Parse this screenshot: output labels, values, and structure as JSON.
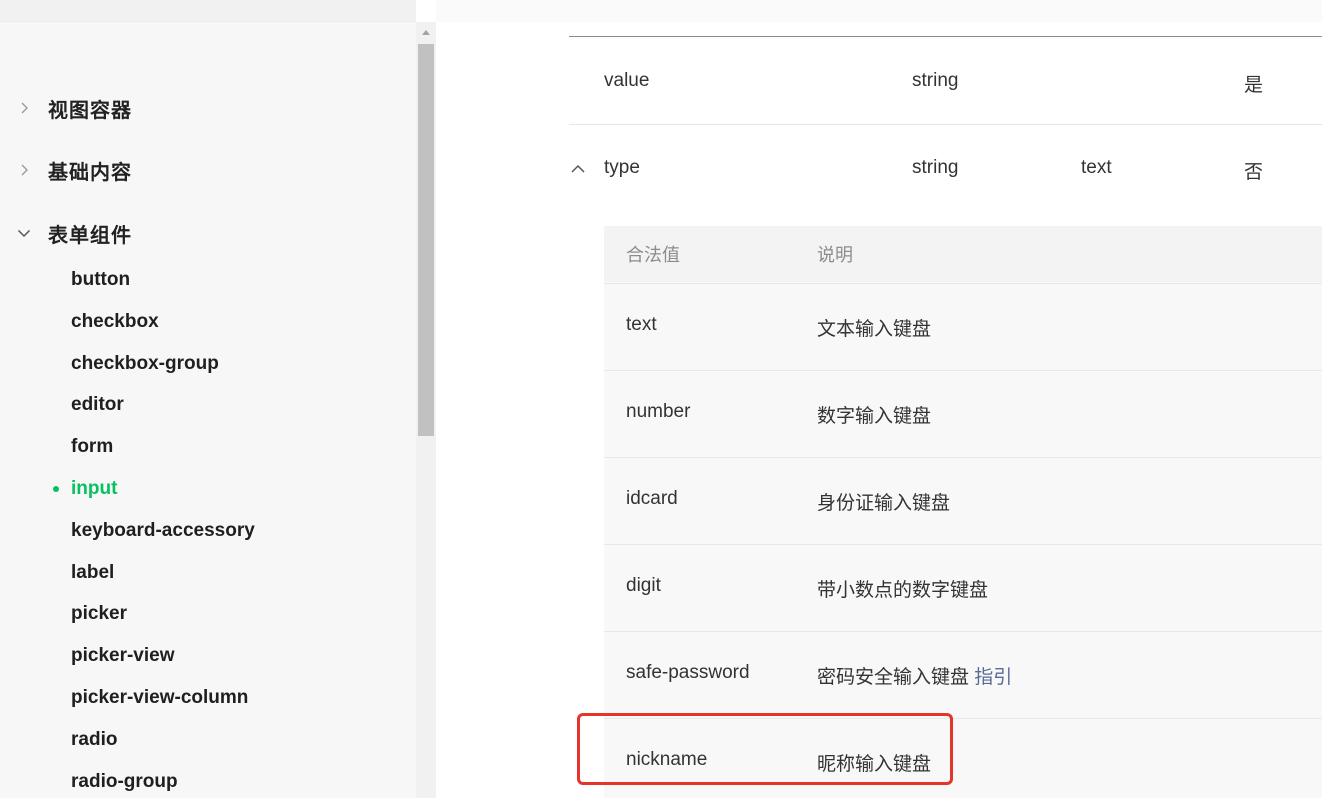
{
  "sidebar": {
    "categories": [
      {
        "label": "视图容器",
        "expanded": false
      },
      {
        "label": "基础内容",
        "expanded": false
      },
      {
        "label": "表单组件",
        "expanded": true
      }
    ],
    "items": [
      "button",
      "checkbox",
      "checkbox-group",
      "editor",
      "form",
      "input",
      "keyboard-accessory",
      "label",
      "picker",
      "picker-view",
      "picker-view-column",
      "radio",
      "radio-group"
    ],
    "active_item": "input"
  },
  "table": {
    "rows": [
      {
        "name": "value",
        "type": "string",
        "default": "",
        "required": "是"
      },
      {
        "name": "type",
        "type": "string",
        "default": "text",
        "required": "否"
      }
    ],
    "inner": {
      "headers": [
        "合法值",
        "说明"
      ],
      "rows": [
        {
          "value": "text",
          "desc": "文本输入键盘"
        },
        {
          "value": "number",
          "desc": "数字输入键盘"
        },
        {
          "value": "idcard",
          "desc": "身份证输入键盘"
        },
        {
          "value": "digit",
          "desc": "带小数点的数字键盘"
        },
        {
          "value": "safe-password",
          "desc": "密码安全输入键盘",
          "link": "指引"
        },
        {
          "value": "nickname",
          "desc": "昵称输入键盘"
        }
      ]
    }
  },
  "colors": {
    "accent": "#07c160",
    "link": "#576b95",
    "highlight": "#e5342c"
  }
}
